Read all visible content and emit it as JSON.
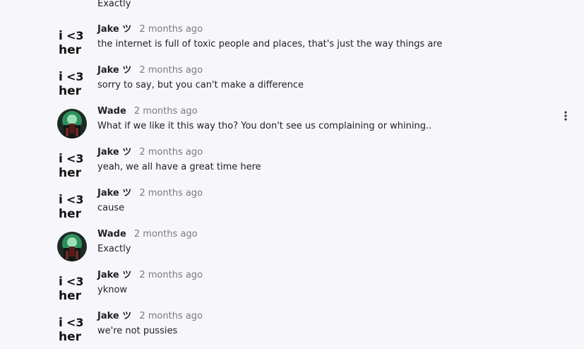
{
  "top_message": "Exactly",
  "messages": [
    {
      "author": "Jake ツ",
      "time": "2 months ago",
      "text": "the internet is full of toxic people and places, that's just the way things are",
      "avatar": "i-heart-her-avatar"
    },
    {
      "author": "Jake ツ",
      "time": "2 months ago",
      "text": "sorry to say, but you can't make a difference",
      "avatar": "i-heart-her-avatar"
    },
    {
      "author": "Wade",
      "time": "2 months ago",
      "text": "What if we like it this way tho? You don't see us complaining or whining..",
      "avatar": "green-character-avatar"
    },
    {
      "author": "Jake ツ",
      "time": "2 months ago",
      "text": "yeah, we all have a great time here",
      "avatar": "i-heart-her-avatar"
    },
    {
      "author": "Jake ツ",
      "time": "2 months ago",
      "text": "cause",
      "avatar": "i-heart-her-avatar"
    },
    {
      "author": "Wade",
      "time": "2 months ago",
      "text": "Exactly",
      "avatar": "green-character-avatar"
    },
    {
      "author": "Jake ツ",
      "time": "2 months ago",
      "text": "yknow",
      "avatar": "i-heart-her-avatar"
    },
    {
      "author": "Jake ツ",
      "time": "2 months ago",
      "text": "we're not pussies",
      "avatar": "i-heart-her-avatar"
    }
  ],
  "icons": {
    "more": "more-vertical-icon"
  },
  "colors": {
    "background": "#f7f7fb",
    "author": "#202124",
    "timestamp": "#7a7a7a",
    "text": "#1f1f1f"
  }
}
